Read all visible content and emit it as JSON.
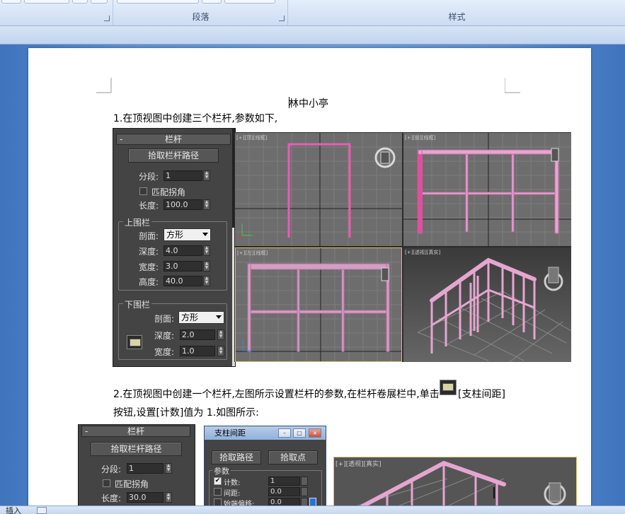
{
  "ribbon": {
    "paragraph_group_label": "段落",
    "styles_group_label": "样式"
  },
  "document": {
    "title": "林中小亭",
    "step1": "1.在顶视图中创建三个栏杆,参数如下,",
    "step2_line1_a": "2.在顶视图中创建一个栏杆,左图所示设置栏杆的参数,在栏杆卷展栏中,单击",
    "step2_line1_b": "[支柱间距]",
    "step2_line2": "按钮,设置[计数]值为 1.如图所示:"
  },
  "panel1": {
    "rollout_title": "栏杆",
    "pick_path_button": "拾取栏杆路径",
    "segments_label": "分段:",
    "segments_value": "1",
    "match_corners_label": "匹配拐角",
    "length_label": "长度:",
    "length_value": "100.0",
    "top_rail_group": "上围栏",
    "top_profile_label": "剖面:",
    "top_profile_value": "方形",
    "top_depth_label": "深度:",
    "top_depth_value": "4.0",
    "top_width_label": "宽度:",
    "top_width_value": "3.0",
    "top_height_label": "高度:",
    "top_height_value": "40.0",
    "bottom_rail_group": "下围栏",
    "bottom_profile_label": "剖面:",
    "bottom_profile_value": "方形",
    "bottom_depth_label": "深度:",
    "bottom_depth_value": "2.0",
    "bottom_width_label": "宽度:",
    "bottom_width_value": "1.0"
  },
  "viewports": {
    "top_left_label": "[+][顶][线框]",
    "top_right_label": "[+][前][线框]",
    "bottom_left_label": "[+][左][线框]",
    "bottom_right_label": "[+][透视][真实]"
  },
  "panel2": {
    "rollout_title": "栏杆",
    "pick_path_button": "拾取栏杆路径",
    "segments_label": "分段:",
    "segments_value": "1",
    "match_corners_label": "匹配拐角",
    "length_label": "长度:",
    "length_value": "30.0"
  },
  "dialog": {
    "title": "支柱间距",
    "pick_path_button": "拾取路径",
    "pick_point_button": "拾取点",
    "params_group": "参数",
    "count_label": "计数:",
    "count_value": "1",
    "spacing_label": "间距:",
    "spacing_value": "0.0",
    "start_offset_label": "始端偏移:",
    "start_offset_value": "0.0"
  },
  "viewport3_label": "[+][透视][真实]",
  "statusbar": {
    "left_label": "插入"
  },
  "colors": {
    "rail_pink": "#e070b0",
    "panel_bg": "#444444",
    "viewport_bg": "#6b6b6b"
  }
}
